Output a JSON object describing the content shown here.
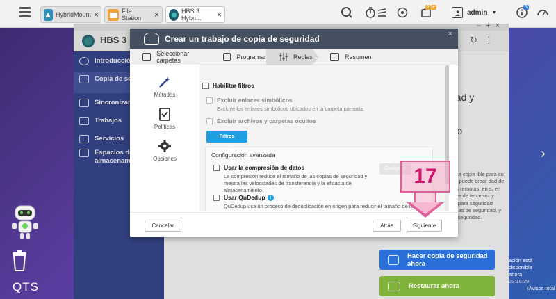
{
  "topbar": {
    "tabs": [
      {
        "label": "HybridMount"
      },
      {
        "label": "File Station"
      },
      {
        "label": "HBS 3 Hybri..."
      }
    ],
    "notification_badge": "10+",
    "info_badge": "5",
    "user": "admin"
  },
  "desktop": {
    "qts_label": "QTS",
    "notif_line1": "ación está disponible",
    "notif_line2": "ahora",
    "notif_time": "23:16:39",
    "notif_line3": "(Avisos total"
  },
  "hbs": {
    "app_name": "HBS 3",
    "sidebar": [
      {
        "label": "Introducción"
      },
      {
        "label": "Copia de seg... restauración"
      },
      {
        "label": "Sincronizar"
      },
      {
        "label": "Trabajos"
      },
      {
        "label": "Servicios"
      },
      {
        "label": "Espacios de almacenami..."
      }
    ],
    "main": {
      "heading_fragment_1": "dad y",
      "heading_fragment_2": "illo",
      "body_text": "ntener una copia ible para su ún varios puede crear dad de sus datos remotos, en s, en otros nube de terceros. y potentes para seguridad estadísticas de seguridad, y copia de seguridad.",
      "backup_button": "Hacer copia de seguridad ahora",
      "restore_button": "Restaurar ahora"
    }
  },
  "modal": {
    "title": "Crear un trabajo de copia de seguridad",
    "steps": [
      {
        "label": "Seleccionar carpetas"
      },
      {
        "label": "Programar"
      },
      {
        "label": "Reglas"
      },
      {
        "label": "Resumen"
      }
    ],
    "side": [
      {
        "label": "Métodos"
      },
      {
        "label": "Políticas"
      },
      {
        "label": "Opciones"
      }
    ],
    "content": {
      "enable_filters": "Habilitar filtros",
      "exclude_symlinks": "Excluir enlaces simbólicos",
      "exclude_symlinks_desc": "Excluye los enlaces simbólicos ubicados en la carpeta pareada.",
      "exclude_hidden": "Excluir archivos y carpetas ocultos",
      "advanced_filters_button": "Filtros avanzados",
      "advanced_section": "Configuración avanzada",
      "compression_label": "Usar la compresión de datos",
      "compression_desc": "La compresión reduce el tamaño de las copias de seguridad y mejora las velocidades de transferencia y la eficacia de almacenamiento.",
      "configure_button": "Configurar",
      "qudedup_label": "Usar QuDedup",
      "qudedup_desc": "QuDedup usa un proceso de deduplicación en origen para reducir el tamaño de las copias de"
    },
    "footer": {
      "cancel": "Cancelar",
      "back": "Atrás",
      "next": "Siguiente"
    }
  },
  "annotation": {
    "step_number": "17"
  }
}
